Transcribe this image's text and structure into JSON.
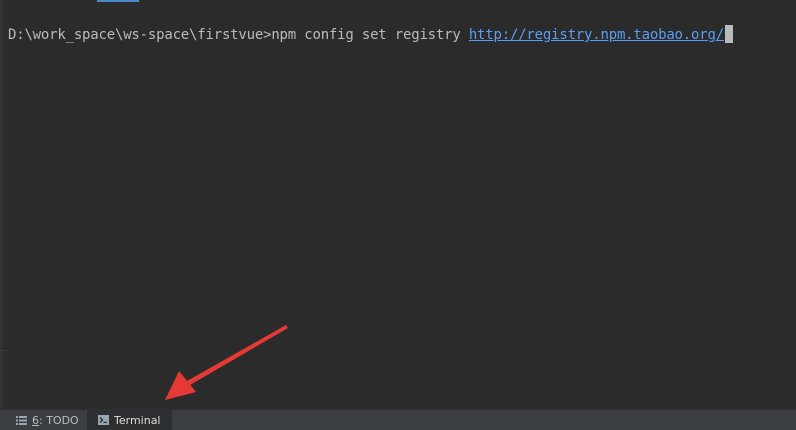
{
  "terminal": {
    "prompt": "D:\\work_space\\ws-space\\firstvue>",
    "command": "npm config set registry ",
    "url": "http://registry.npm.taobao.org/"
  },
  "tool_windows": {
    "todo": {
      "mnemonic": "6",
      "label": ": TODO"
    },
    "terminal": {
      "label": "Terminal"
    }
  },
  "icons": {
    "todo": "list-icon",
    "terminal": "terminal-icon"
  },
  "colors": {
    "background": "#2b2b2b",
    "text": "#bbbbbb",
    "link": "#589df6",
    "annotation_arrow": "#e53935",
    "tab_indicator": "#4a88c7"
  }
}
